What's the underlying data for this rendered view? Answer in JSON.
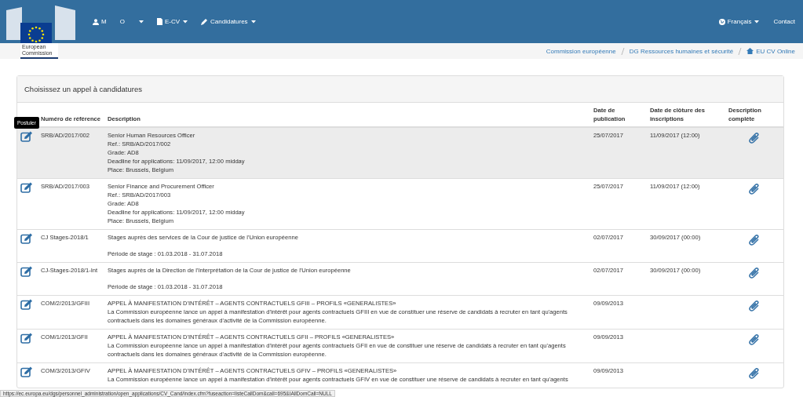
{
  "logo": {
    "caption_lines": [
      "European",
      "Commission"
    ]
  },
  "nav": {
    "left": [
      {
        "kind": "user",
        "label": "M",
        "caret": false
      },
      {
        "kind": "text",
        "label": "O",
        "caret": false
      },
      {
        "kind": "caret",
        "caret": true
      },
      {
        "kind": "file",
        "label": "E-CV",
        "caret": true
      },
      {
        "kind": "pencil",
        "label": "Candidatures",
        "caret": true
      }
    ],
    "right": [
      {
        "kind": "globe",
        "label": "Français",
        "caret": true
      },
      {
        "kind": "text",
        "label": "Contact",
        "caret": false
      }
    ]
  },
  "breadcrumb": [
    {
      "label": "Commission européenne",
      "home": false
    },
    {
      "label": "DG Ressources humaines et sécurité",
      "home": false
    },
    {
      "label": "EU CV Online",
      "home": true
    }
  ],
  "panel": {
    "title": "Choisissez un appel à candidatures"
  },
  "table": {
    "columns": [
      "",
      "Numéro de référence",
      "Description",
      "Date de publication",
      "Date de clôture des inscriptions",
      "Description complète"
    ],
    "rows": [
      {
        "highlighted": true,
        "tooltip": "Postuler",
        "reference": "SRB/AD/2017/002",
        "paragraphs": [
          [
            "Senior Human Resources Officer",
            "Ref.: SRB/AD/2017/002",
            "Grade: AD8",
            "Deadline for applications: 11/09/2017, 12:00 midday",
            "Place: Brussels, Belgium"
          ]
        ],
        "published": "25/07/2017",
        "closing": "11/09/2017 (12:00)"
      },
      {
        "highlighted": false,
        "reference": "SRB/AD/2017/003",
        "paragraphs": [
          [
            "Senior Finance and Procurement Officer",
            "Ref.: SRB/AD/2017/003",
            "Grade: AD8",
            "Deadline for applications: 11/09/2017, 12:00 midday",
            "Place: Brussels, Belgium"
          ]
        ],
        "published": "25/07/2017",
        "closing": "11/09/2017 (12:00)"
      },
      {
        "highlighted": false,
        "reference": "CJ Stages-2018/1",
        "paragraphs": [
          [
            "Stages auprès des services de la Cour de justice de l'Union européenne"
          ],
          [
            "Période de stage : 01.03.2018 - 31.07.2018"
          ]
        ],
        "published": "02/07/2017",
        "closing": "30/09/2017 (00:00)"
      },
      {
        "highlighted": false,
        "reference": "CJ-Stages-2018/1-Int",
        "paragraphs": [
          [
            "Stages auprès de la Direction de l'Interprétation de la Cour de justice de l'Union européenne"
          ],
          [
            "Période de stage : 01.03.2018 - 31.07.2018"
          ]
        ],
        "published": "02/07/2017",
        "closing": "30/09/2017 (00:00)"
      },
      {
        "highlighted": false,
        "reference": "COM/2/2013/GFIII",
        "paragraphs": [
          [
            "APPEL À MANIFESTATION D'INTÉRÊT – AGENTS CONTRACTUELS GFIII – PROFILS «GENERALISTES»",
            "La Commission européenne lance un appel à manifestation d'intérêt pour agents contractuels GFIII en vue de constituer une réserve de candidats à recruter en tant qu'agents",
            "contractuels dans les domaines généraux d'activité de la Commission européenne."
          ]
        ],
        "published": "09/09/2013"
      },
      {
        "highlighted": false,
        "reference": "COM/1/2013/GFII",
        "paragraphs": [
          [
            "APPEL À MANIFESTATION D'INTÉRÊT – AGENTS CONTRACTUELS GFII – PROFILS «GENERALISTES»",
            "La Commission européenne lance un appel à manifestation d'intérêt pour agents contractuels GFII en vue de constituer une réserve de candidats à recruter en tant qu'agents",
            "contractuels dans les domaines généraux d'activité de la Commission européenne."
          ]
        ],
        "published": "09/09/2013"
      },
      {
        "highlighted": false,
        "reference": "COM/3/2013/GFIV",
        "paragraphs": [
          [
            "APPEL À MANIFESTATION D'INTÉRÊT – AGENTS CONTRACTUELS GFIV – PROFILS «GENERALISTES»",
            "La Commission européenne lance un appel à manifestation d'intérêt pour agents contractuels GFIV en vue de constituer une réserve de candidats à recruter en tant qu'agents"
          ]
        ],
        "published": "09/09/2013"
      }
    ]
  },
  "status_url": "https://ec.europa.eu/dgs/personnel_administration/open_applications/CV_Cand/index.cfm?fuseaction=listeCallDom&call=695&IAllDomCall=NULL"
}
